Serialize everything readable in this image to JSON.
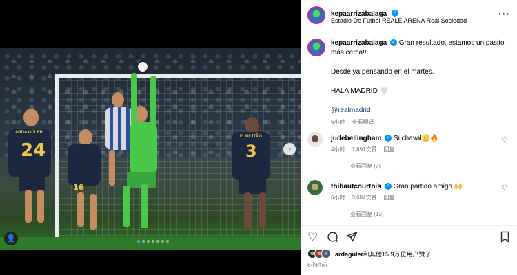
{
  "post": {
    "username": "kepaarrizabalaga",
    "location": "Estadio De Fútbol REALE ARENA Real Sociedad",
    "caption": {
      "line1": "Gran resultado, estamos un pasito",
      "line2": "más cerca!!",
      "line3": "Desde ya pensando en el martes.",
      "line4": "HALA MADRID 🤍",
      "mention": "@realmadrid"
    },
    "caption_meta": {
      "time": "6小时",
      "translate": "查看翻译"
    }
  },
  "photo": {
    "jersey_left": "24",
    "name_left": "ARDA GÜLER",
    "jersey_right": "3",
    "name_right": "E. MILITÃO",
    "jersey_mid": "16"
  },
  "comments": [
    {
      "username": "judebellingham",
      "text": "Si chaval🫡🔥",
      "time": "4小时",
      "likes": "1,891次赞",
      "reply": "回复",
      "view_replies": "查看回复 (7)"
    },
    {
      "username": "thibautcourtois",
      "text": "Gran partido amigo 🙌",
      "time": "6小时",
      "likes": "3,684次赞",
      "reply": "回复",
      "view_replies": "查看回复 (13)"
    }
  ],
  "actions": {
    "like_icon": "heart-icon",
    "comment_icon": "comment-icon",
    "share_icon": "send-icon",
    "save_icon": "bookmark-icon"
  },
  "likes_summary": "arda.guler和其他15.9万位用户赞了",
  "likes_user": "ardaguler",
  "likes_rest": "和其他15.9万位用户赞了",
  "post_time": "6小时前",
  "colors": {
    "verified": "#0095f6",
    "keeper_kit": "#49c84a",
    "madrid_kit": "#1c2740"
  }
}
